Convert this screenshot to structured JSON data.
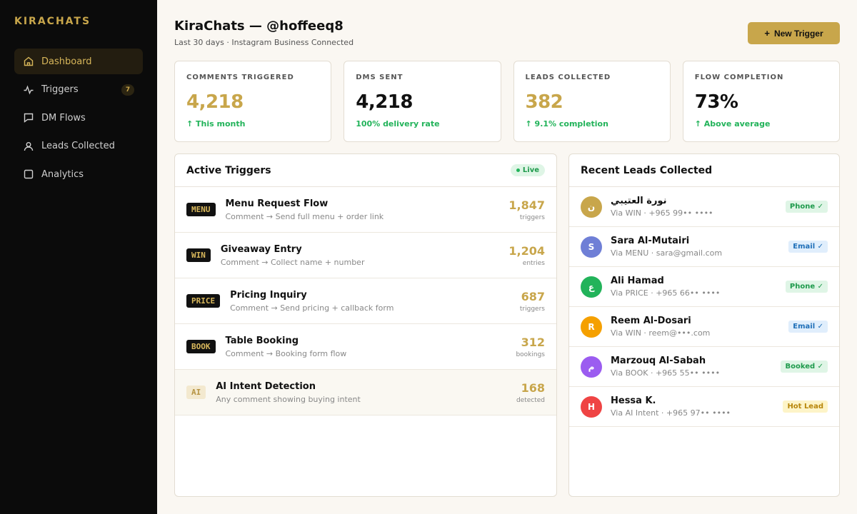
{
  "sidebar": {
    "brand": "KIRACHATS",
    "items": [
      {
        "label": "Dashboard",
        "icon": "home-icon",
        "active": true
      },
      {
        "label": "Triggers",
        "icon": "pulse-icon",
        "badge": "7"
      },
      {
        "label": "DM Flows",
        "icon": "chat-icon"
      },
      {
        "label": "Leads Collected",
        "icon": "user-icon"
      },
      {
        "label": "Analytics",
        "icon": "square-icon"
      }
    ]
  },
  "header": {
    "title": "KiraChats — @hoffeeq8",
    "subtitle": "Last 30 days · Instagram Business Connected",
    "new_trigger_label": "New Trigger",
    "new_trigger_icon": "+"
  },
  "stats": [
    {
      "label": "COMMENTS TRIGGERED",
      "value": "4,218",
      "note": "↑ This month",
      "color": "gold"
    },
    {
      "label": "DMS SENT",
      "value": "4,218",
      "note": "100% delivery rate",
      "color": "dark"
    },
    {
      "label": "LEADS COLLECTED",
      "value": "382",
      "note": "↑ 9.1% completion",
      "color": "gold"
    },
    {
      "label": "FLOW COMPLETION",
      "value": "73%",
      "note": "↑ Above average",
      "color": "dark"
    }
  ],
  "triggers": {
    "title": "Active Triggers",
    "live_label": "Live",
    "rows": [
      {
        "keyword": "MENU",
        "name": "Menu Request Flow",
        "desc": "Comment → Send full menu + order link",
        "count": "1,847",
        "unit": "triggers"
      },
      {
        "keyword": "WIN",
        "name": "Giveaway Entry",
        "desc": "Comment → Collect name + number",
        "count": "1,204",
        "unit": "entries"
      },
      {
        "keyword": "PRICE",
        "name": "Pricing Inquiry",
        "desc": "Comment → Send pricing + callback form",
        "count": "687",
        "unit": "triggers"
      },
      {
        "keyword": "BOOK",
        "name": "Table Booking",
        "desc": "Comment → Booking form flow",
        "count": "312",
        "unit": "bookings"
      },
      {
        "keyword": "AI",
        "name": "AI Intent Detection",
        "desc": "Any comment showing buying intent",
        "count": "168",
        "unit": "detected",
        "ai": true
      }
    ]
  },
  "leads": {
    "title": "Recent Leads Collected",
    "rows": [
      {
        "initial": "ن",
        "name": "نورة العتيبي",
        "meta": "Via WIN · +965 99•• ••••",
        "tag": "Phone ✓",
        "avatar_color": "#c8a64b",
        "tag_bg": "#dff5e6",
        "tag_fg": "#1e9a4c"
      },
      {
        "initial": "S",
        "name": "Sara Al-Mutairi",
        "meta": "Via MENU · sara@gmail.com",
        "tag": "Email ✓",
        "avatar_color": "#6f7fd6",
        "tag_bg": "#e0eefc",
        "tag_fg": "#1f6fb8"
      },
      {
        "initial": "ع",
        "name": "Ali Hamad",
        "meta": "Via PRICE · +965 66•• ••••",
        "tag": "Phone ✓",
        "avatar_color": "#22b35a",
        "tag_bg": "#dff5e6",
        "tag_fg": "#1e9a4c"
      },
      {
        "initial": "R",
        "name": "Reem Al-Dosari",
        "meta": "Via WIN · reem@•••.com",
        "tag": "Email ✓",
        "avatar_color": "#f5a000",
        "tag_bg": "#e0eefc",
        "tag_fg": "#1f6fb8"
      },
      {
        "initial": "م",
        "name": "Marzouq Al-Sabah",
        "meta": "Via BOOK · +965 55•• ••••",
        "tag": "Booked ✓",
        "avatar_color": "#9b5cf0",
        "tag_bg": "#dff5e6",
        "tag_fg": "#1e9a4c"
      },
      {
        "initial": "H",
        "name": "Hessa K.",
        "meta": "Via AI Intent · +965 97•• ••••",
        "tag": "Hot Lead",
        "avatar_color": "#ef4444",
        "tag_bg": "#fdf4c8",
        "tag_fg": "#b8860b"
      }
    ]
  }
}
